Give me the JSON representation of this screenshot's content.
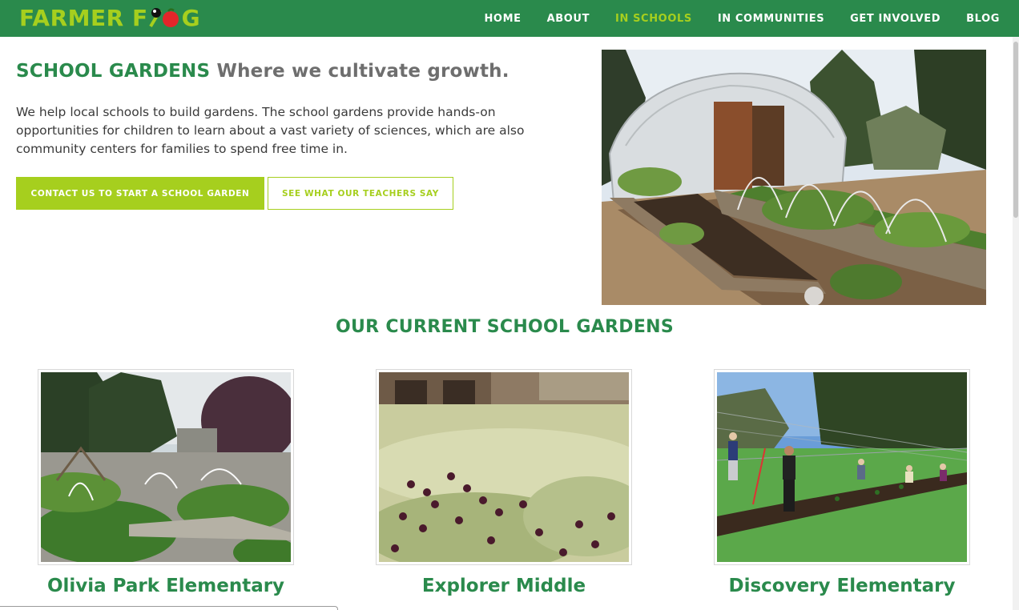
{
  "nav": {
    "logo_text_left": "FARMER F",
    "logo_text_right": "G",
    "links": [
      {
        "label": "HOME",
        "active": false
      },
      {
        "label": "ABOUT",
        "active": false
      },
      {
        "label": "IN SCHOOLS",
        "active": true
      },
      {
        "label": "IN COMMUNITIES",
        "active": false
      },
      {
        "label": "GET INVOLVED",
        "active": false
      },
      {
        "label": "BLOG",
        "active": false
      }
    ]
  },
  "hero": {
    "title_green": "SCHOOL GARDENS",
    "title_gray": "Where we cultivate growth.",
    "description": "We help local schools to build gardens. The school gardens provide hands-on opportunities for children to learn about a vast variety of sciences, which are also community centers for families to spend free time in.",
    "primary_button": "CONTACT US TO START A SCHOOL GARDEN",
    "secondary_button": "SEE WHAT OUR TEACHERS SAY"
  },
  "gardens": {
    "section_title": "OUR CURRENT SCHOOL GARDENS",
    "items": [
      {
        "name": "Olivia Park Elementary"
      },
      {
        "name": "Explorer Middle"
      },
      {
        "name": "Discovery Elementary"
      }
    ]
  },
  "colors": {
    "brand_green": "#2a8a4c",
    "accent_lime": "#a6cf1e",
    "title_gray": "#6e6e6e"
  }
}
